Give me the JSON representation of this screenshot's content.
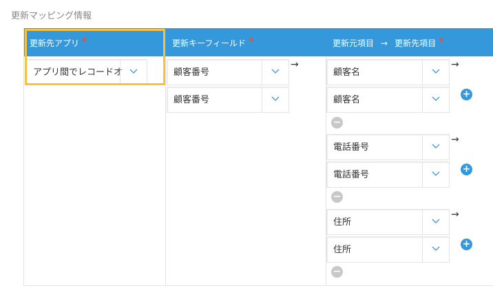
{
  "section_title": "更新マッピング情報",
  "columns": {
    "target_app": "更新先アプリ",
    "update_key": "更新キーフィールド",
    "source_field": "更新元項目",
    "arrow": "→",
    "target_field": "更新先項目",
    "required_mark": "*"
  },
  "target_app_select": {
    "value": "アプリ間でレコード",
    "trail": "オ"
  },
  "key_fields": [
    "顧客番号",
    "顧客番号"
  ],
  "mappings": [
    {
      "source": "顧客名",
      "target": "顧客名"
    },
    {
      "source": "電話番号",
      "target": "電話番号"
    },
    {
      "source": "住所",
      "target": "住所"
    }
  ],
  "glyphs": {
    "arrow": "→",
    "add": "+",
    "remove": "−"
  },
  "colors": {
    "header": "#3498db",
    "required": "#e74c3c",
    "highlight": "#f5c342",
    "add_button": "#3498db",
    "remove_button": "#c8c8c8"
  }
}
